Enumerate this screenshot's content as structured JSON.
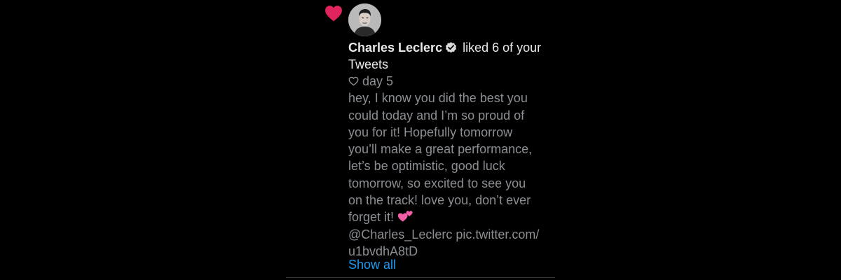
{
  "notification": {
    "icon": "heart-icon",
    "accent_color": "#e0245e",
    "actor_name": "Charles Leclerc",
    "verified_icon": "verified-badge-icon",
    "action_text": " liked 6 of your Tweets"
  },
  "tweet": {
    "title_icon": "heart-outline-icon",
    "title": "day 5",
    "body": "hey, I know you did the best you\ncould today and I’m so proud of\nyou for it! Hopefully tomorrow\nyou’ll make a great performance,\nlet’s be optimistic, good luck\ntomorrow, so excited to see you\non the track! love you, don’t ever\nforget it! ",
    "emoji_icon": "two-hearts-emoji-icon",
    "links": "@Charles_Leclerc pic.twitter.com/\nu1bvdhA8tD"
  },
  "show_all_label": "Show all",
  "colors": {
    "background": "#000000",
    "primary_text": "#e7e9ea",
    "secondary_text": "#8b8f93",
    "link": "#1d9bf0",
    "emoji_pink": "#f25fa6"
  }
}
